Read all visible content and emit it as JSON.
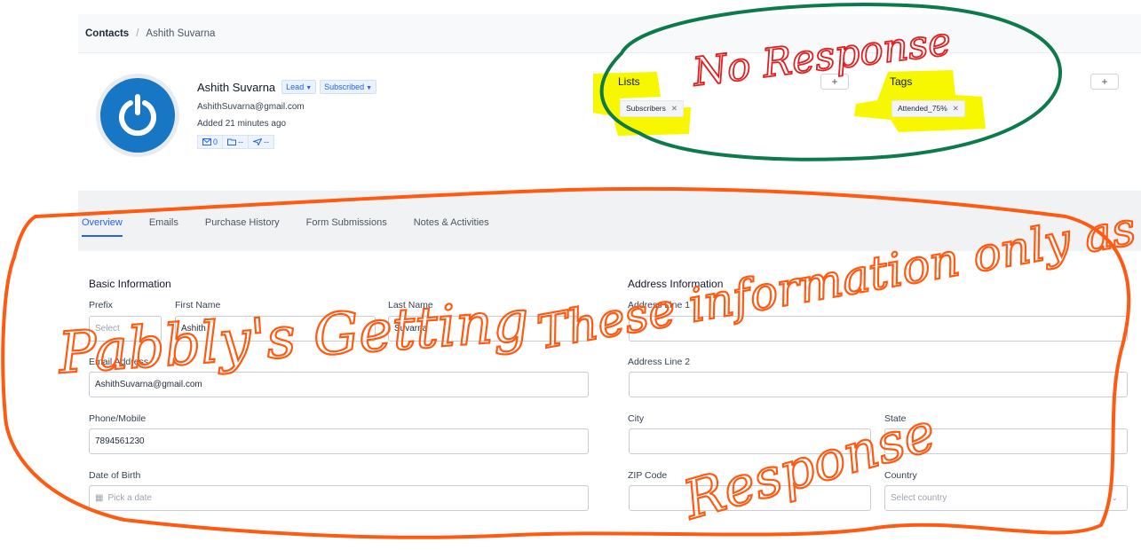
{
  "breadcrumb": {
    "root": "Contacts",
    "separator": "/",
    "current": "Ashith Suvarna"
  },
  "contact": {
    "name": "Ashith Suvarna",
    "status_badge": "Lead",
    "subscription_badge": "Subscribed",
    "email": "AshithSuvarna@gmail.com",
    "added": "Added 21 minutes ago",
    "stats": {
      "emails": "0",
      "lists": "--",
      "campaigns": "--"
    }
  },
  "lists": {
    "title": "Lists",
    "items": [
      "Subscribers"
    ],
    "add_label": "+"
  },
  "tags": {
    "title": "Tags",
    "items": [
      "Attended_75%"
    ],
    "add_label": "+"
  },
  "tabs": [
    "Overview",
    "Emails",
    "Purchase History",
    "Form Submissions",
    "Notes & Activities"
  ],
  "active_tab": "Overview",
  "basic_info": {
    "title": "Basic Information",
    "prefix": {
      "label": "Prefix",
      "placeholder": "Select"
    },
    "first_name": {
      "label": "First Name",
      "value": "Ashith"
    },
    "last_name": {
      "label": "Last Name",
      "value": "Suvarna"
    },
    "email": {
      "label": "Email Address",
      "value": "AshithSuvarna@gmail.com"
    },
    "phone": {
      "label": "Phone/Mobile",
      "value": "7894561230"
    },
    "dob": {
      "label": "Date of Birth",
      "placeholder": "Pick a date"
    }
  },
  "address_info": {
    "title": "Address Information",
    "line1": {
      "label": "Address Line 1",
      "value": ""
    },
    "line2": {
      "label": "Address Line 2",
      "value": ""
    },
    "city": {
      "label": "City",
      "value": ""
    },
    "state": {
      "label": "State",
      "value": ""
    },
    "zip": {
      "label": "ZIP Code",
      "value": ""
    },
    "country": {
      "label": "Country",
      "placeholder": "Select country"
    }
  },
  "annotations": {
    "top": "No Response",
    "bottom_left": "Pabbly's Getting",
    "bottom_middle": "These information only as a",
    "bottom_right": "Response"
  },
  "colors": {
    "accent": "#2563eb",
    "brand_avatar": "#1877c4",
    "highlight": "#f7f700",
    "annotation_green": "#0d7a4b",
    "annotation_red": "#e02020",
    "annotation_orange": "#ff5a12"
  }
}
